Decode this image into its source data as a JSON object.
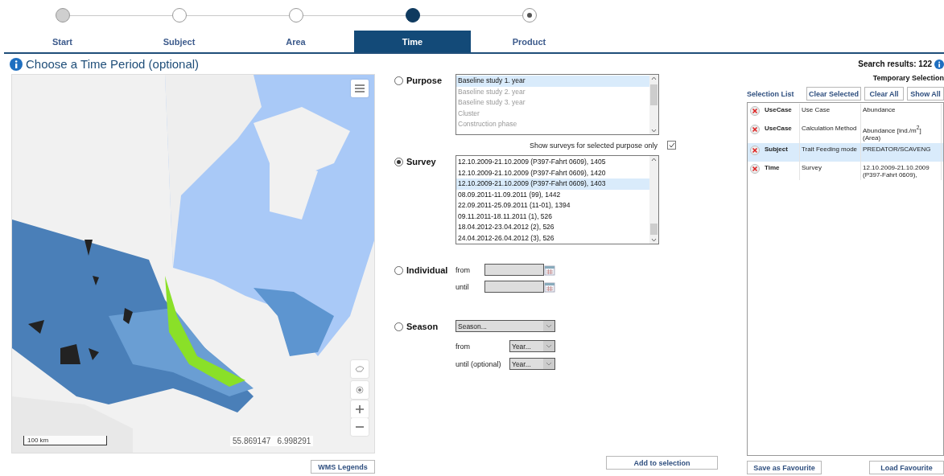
{
  "steps": [
    {
      "label": "Start",
      "selected": false,
      "kind": "done"
    },
    {
      "label": "Subject",
      "selected": false,
      "kind": "open"
    },
    {
      "label": "Area",
      "selected": false,
      "kind": "open"
    },
    {
      "label": "Time",
      "selected": true,
      "kind": "current"
    },
    {
      "label": "Product",
      "selected": false,
      "kind": "end"
    }
  ],
  "heading": "Choose a Time Period (optional)",
  "map": {
    "scale": "100 km",
    "coordinates": "55.869147   6.998291",
    "legend_button": "WMS Legends"
  },
  "purpose": {
    "label": "Purpose",
    "selected": false,
    "items": [
      {
        "text": "Baseline study 1. year",
        "selected": true,
        "disabled": false
      },
      {
        "text": "Baseline study 2. year",
        "selected": false,
        "disabled": true
      },
      {
        "text": "Baseline study 3. year",
        "selected": false,
        "disabled": true
      },
      {
        "text": "Cluster",
        "selected": false,
        "disabled": true
      },
      {
        "text": "Construction phase",
        "selected": false,
        "disabled": true
      }
    ]
  },
  "filter": {
    "label": "Show surveys for selected purpose only",
    "checked": true
  },
  "survey": {
    "label": "Survey",
    "selected": true,
    "items": [
      {
        "text": "12.10.2009-21.10.2009 (P397-Fahrt 0609), 1405",
        "selected": false
      },
      {
        "text": "12.10.2009-21.10.2009 (P397-Fahrt 0609), 1420",
        "selected": false
      },
      {
        "text": "12.10.2009-21.10.2009 (P397-Fahrt 0609), 1403",
        "selected": true
      },
      {
        "text": "08.09.2011-11.09.2011 (99), 1442",
        "selected": false
      },
      {
        "text": "22.09.2011-25.09.2011 (11-01), 1394",
        "selected": false
      },
      {
        "text": "09.11.2011-18.11.2011 (1), 526",
        "selected": false
      },
      {
        "text": "18.04.2012-23.04.2012 (2), 526",
        "selected": false
      },
      {
        "text": "24.04.2012-26.04.2012 (3), 526",
        "selected": false
      }
    ]
  },
  "individual": {
    "label": "Individual",
    "selected": false,
    "from": "from",
    "until": "until"
  },
  "season": {
    "label": "Season",
    "selected": false,
    "season_placeholder": "Season...",
    "from": "from",
    "from_placeholder": "Year...",
    "until": "until (optional)",
    "until_placeholder": "Year..."
  },
  "add_button": "Add to selection",
  "search_results": "Search results: 122",
  "temporary_selection": "Temporary Selection",
  "selection_list": {
    "title": "Selection List",
    "buttons": [
      "Clear Selected",
      "Clear All",
      "Show All"
    ],
    "rows": [
      {
        "type": "UseCase",
        "name": "Use Case",
        "value": "Abundance",
        "selected": false
      },
      {
        "type": "UseCase",
        "name": "Calculation Method",
        "value": "Abundance [ind./m$^{2}$] (Area)",
        "selected": false
      },
      {
        "type": "Subject",
        "name": "Trait Feeding mode",
        "value": "PREDATOR/SCAVENG",
        "selected": true
      },
      {
        "type": "Time",
        "name": "Survey",
        "value": "12.10.2009-21.10.2009 (P397-Fahrt 0609),",
        "selected": false
      }
    ]
  },
  "footer_buttons": [
    "Save as Favourite",
    "Load Favourite"
  ]
}
